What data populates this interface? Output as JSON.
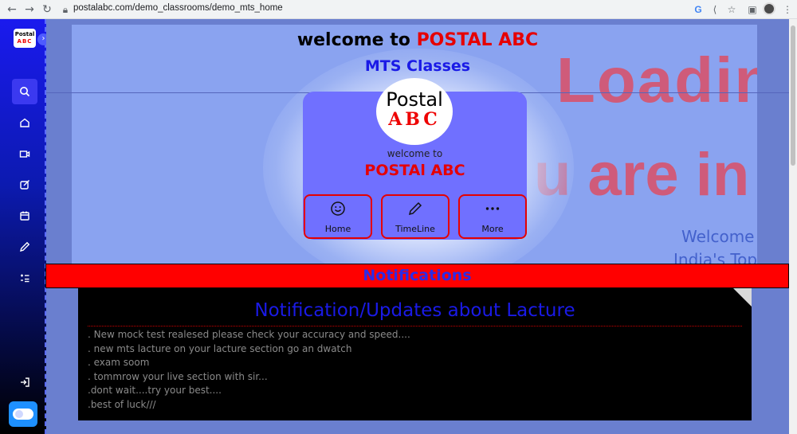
{
  "browser": {
    "url": "postalabc.com/demo_classrooms/demo_mts_home",
    "back_icon": "arrow-left-icon",
    "forward_icon": "arrow-right-icon",
    "reload_icon": "reload-icon"
  },
  "sidebar": {
    "logo_line1": "Postal",
    "logo_line2": "ABC",
    "toggle": "›",
    "items": [
      {
        "icon": "search-icon",
        "glyph": "⌕"
      },
      {
        "icon": "home-icon",
        "glyph": "⌂"
      },
      {
        "icon": "video-icon",
        "glyph": "▭"
      },
      {
        "icon": "edit-icon",
        "glyph": "✎"
      },
      {
        "icon": "calendar-icon",
        "glyph": "▦"
      },
      {
        "icon": "pencil-icon",
        "glyph": "✏"
      },
      {
        "icon": "tasks-icon",
        "glyph": "☰"
      },
      {
        "icon": "logout-icon",
        "glyph": "⇥"
      }
    ]
  },
  "hero": {
    "welcome_prefix": "welcome to ",
    "welcome_brand": "POSTAL ABC",
    "subtitle": "MTS Classes",
    "bg_loading": "Loadin",
    "bg_are": "u are in t",
    "bg_welcome": "Welcome to I",
    "bg_india": "India's Top Pos"
  },
  "card": {
    "logo_line1": "Postal",
    "logo_line2": "ABC",
    "welcome": "welcome to",
    "brand": "POSTAl ABC",
    "buttons": [
      {
        "label": "Home",
        "icon": "smile-icon",
        "glyph": "☺"
      },
      {
        "label": "TimeLine",
        "icon": "pencil-icon",
        "glyph": "✎"
      },
      {
        "label": "More",
        "icon": "more-icon",
        "glyph": "•••"
      }
    ]
  },
  "notifications": {
    "bar_title": "Notifications",
    "heading": "Notification/Updates about Lacture",
    "items": [
      ". New mock test realesed please check your accuracy and speed....",
      ". new mts lacture on your lacture section go an dwatch",
      ". exam soom",
      ". tommrow your live section with sir...",
      ".dont wait....try your best....",
      ".best of luck///"
    ]
  }
}
